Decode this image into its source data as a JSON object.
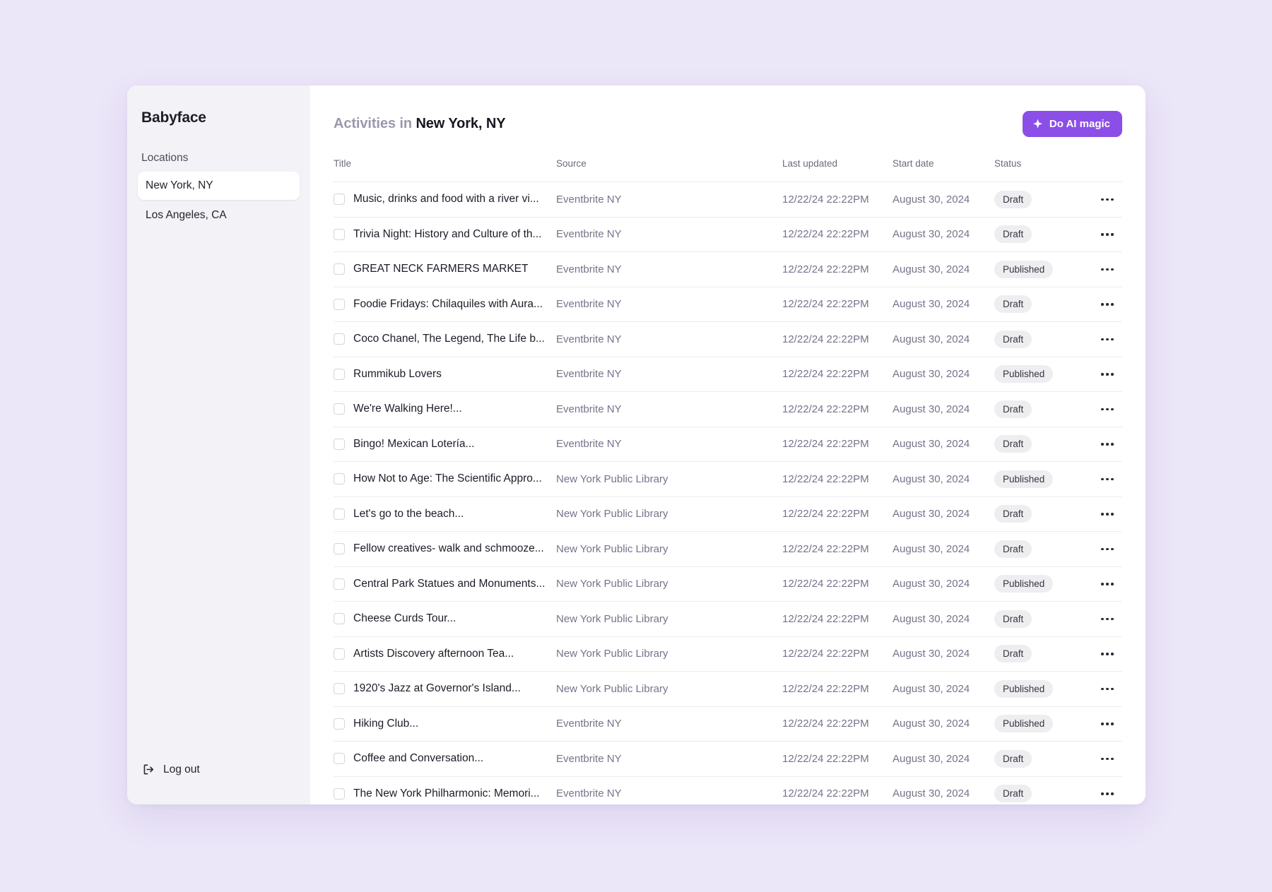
{
  "sidebar": {
    "brand": "Babyface",
    "section_label": "Locations",
    "items": [
      {
        "label": "New York, NY",
        "active": true
      },
      {
        "label": "Los Angeles, CA",
        "active": false
      }
    ],
    "logout_label": "Log out",
    "logout_icon": "logout-icon"
  },
  "header": {
    "title_prefix": "Activities in",
    "title_location": "New York, NY",
    "ai_button_label": "Do AI magic",
    "ai_button_icon": "sparkle-icon",
    "ai_button_color": "#8b4fe8"
  },
  "table": {
    "columns": [
      "Title",
      "Source",
      "Last updated",
      "Start date",
      "Status"
    ],
    "row_menu_icon": "ellipsis-icon",
    "rows": [
      {
        "title": "Music, drinks and food with a river vi...",
        "source": "Eventbrite NY",
        "last_updated": "12/22/24 22:22PM",
        "start_date": "August 30, 2024",
        "status": "Draft"
      },
      {
        "title": "Trivia Night: History and Culture of th...",
        "source": "Eventbrite NY",
        "last_updated": "12/22/24 22:22PM",
        "start_date": "August 30, 2024",
        "status": "Draft"
      },
      {
        "title": "GREAT NECK FARMERS MARKET",
        "source": "Eventbrite NY",
        "last_updated": "12/22/24 22:22PM",
        "start_date": "August 30, 2024",
        "status": "Published"
      },
      {
        "title": "Foodie Fridays: Chilaquiles with Aura...",
        "source": "Eventbrite NY",
        "last_updated": "12/22/24 22:22PM",
        "start_date": "August 30, 2024",
        "status": "Draft"
      },
      {
        "title": "Coco Chanel, The Legend, The Life b...",
        "source": "Eventbrite NY",
        "last_updated": "12/22/24 22:22PM",
        "start_date": "August 30, 2024",
        "status": "Draft"
      },
      {
        "title": "Rummikub Lovers",
        "source": "Eventbrite NY",
        "last_updated": "12/22/24 22:22PM",
        "start_date": "August 30, 2024",
        "status": "Published"
      },
      {
        "title": "We're Walking Here!...",
        "source": "Eventbrite NY",
        "last_updated": "12/22/24 22:22PM",
        "start_date": "August 30, 2024",
        "status": "Draft"
      },
      {
        "title": "Bingo! Mexican Lotería...",
        "source": "Eventbrite NY",
        "last_updated": "12/22/24 22:22PM",
        "start_date": "August 30, 2024",
        "status": "Draft"
      },
      {
        "title": "How Not to Age: The Scientific Appro...",
        "source": "New York Public Library",
        "last_updated": "12/22/24 22:22PM",
        "start_date": "August 30, 2024",
        "status": "Published"
      },
      {
        "title": "Let's go to the beach...",
        "source": "New York Public Library",
        "last_updated": "12/22/24 22:22PM",
        "start_date": "August 30, 2024",
        "status": "Draft"
      },
      {
        "title": "Fellow creatives- walk and schmooze...",
        "source": "New York Public Library",
        "last_updated": "12/22/24 22:22PM",
        "start_date": "August 30, 2024",
        "status": "Draft"
      },
      {
        "title": "Central Park Statues and Monuments...",
        "source": "New York Public Library",
        "last_updated": "12/22/24 22:22PM",
        "start_date": "August 30, 2024",
        "status": "Published"
      },
      {
        "title": "Cheese Curds Tour...",
        "source": "New York Public Library",
        "last_updated": "12/22/24 22:22PM",
        "start_date": "August 30, 2024",
        "status": "Draft"
      },
      {
        "title": "Artists Discovery afternoon Tea...",
        "source": "New York Public Library",
        "last_updated": "12/22/24 22:22PM",
        "start_date": "August 30, 2024",
        "status": "Draft"
      },
      {
        "title": "1920's Jazz at Governor's Island...",
        "source": "New York Public Library",
        "last_updated": "12/22/24 22:22PM",
        "start_date": "August 30, 2024",
        "status": "Published"
      },
      {
        "title": "Hiking Club...",
        "source": "Eventbrite NY",
        "last_updated": "12/22/24 22:22PM",
        "start_date": "August 30, 2024",
        "status": "Published"
      },
      {
        "title": "Coffee and Conversation...",
        "source": "Eventbrite NY",
        "last_updated": "12/22/24 22:22PM",
        "start_date": "August 30, 2024",
        "status": "Draft"
      },
      {
        "title": "The New York Philharmonic: Memori...",
        "source": "Eventbrite NY",
        "last_updated": "12/22/24 22:22PM",
        "start_date": "August 30, 2024",
        "status": "Draft"
      }
    ]
  }
}
